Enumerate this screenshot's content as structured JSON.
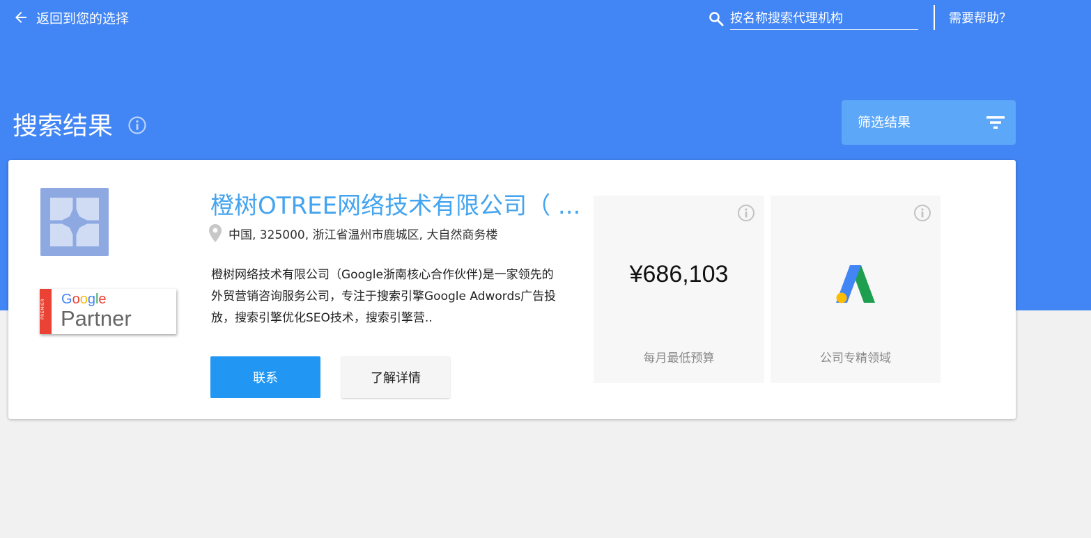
{
  "nav": {
    "back_label": "返回到您的选择",
    "search_placeholder": "按名称搜索代理机构",
    "help_label": "需要帮助？"
  },
  "header": {
    "title": "搜索结果",
    "filter_label": "筛选结果"
  },
  "result": {
    "company_name": "橙树OTREE网络技术有限公司（ ...",
    "address": "中国, 325000, 浙江省温州市鹿城区, 大自然商务楼",
    "description": "橙树网络技术有限公司（Google浙南核心合作伙伴)是一家领先的外贸营销咨询服务公司，专注于搜索引擎Google Adwords广告投放，搜索引擎优化SEO技术，搜索引擎营..",
    "badge": {
      "tier": "PREMIER",
      "brand_letters": [
        "G",
        "o",
        "o",
        "g",
        "l",
        "e"
      ],
      "brand_colors": [
        "#4285f4",
        "#ea4335",
        "#fbbc05",
        "#4285f4",
        "#34a853",
        "#ea4335"
      ],
      "program": "Partner"
    },
    "contact_label": "联系",
    "details_label": "了解详情",
    "budget_value": "¥686,103",
    "budget_label": "每月最低预算",
    "specialty_label": "公司专精领域",
    "specialty_icon": "google-ads-icon"
  },
  "colors": {
    "hero": "#4285f4",
    "filter_button": "#5ca7f8",
    "link": "#44a4ef",
    "primary_button": "#2196f3"
  }
}
